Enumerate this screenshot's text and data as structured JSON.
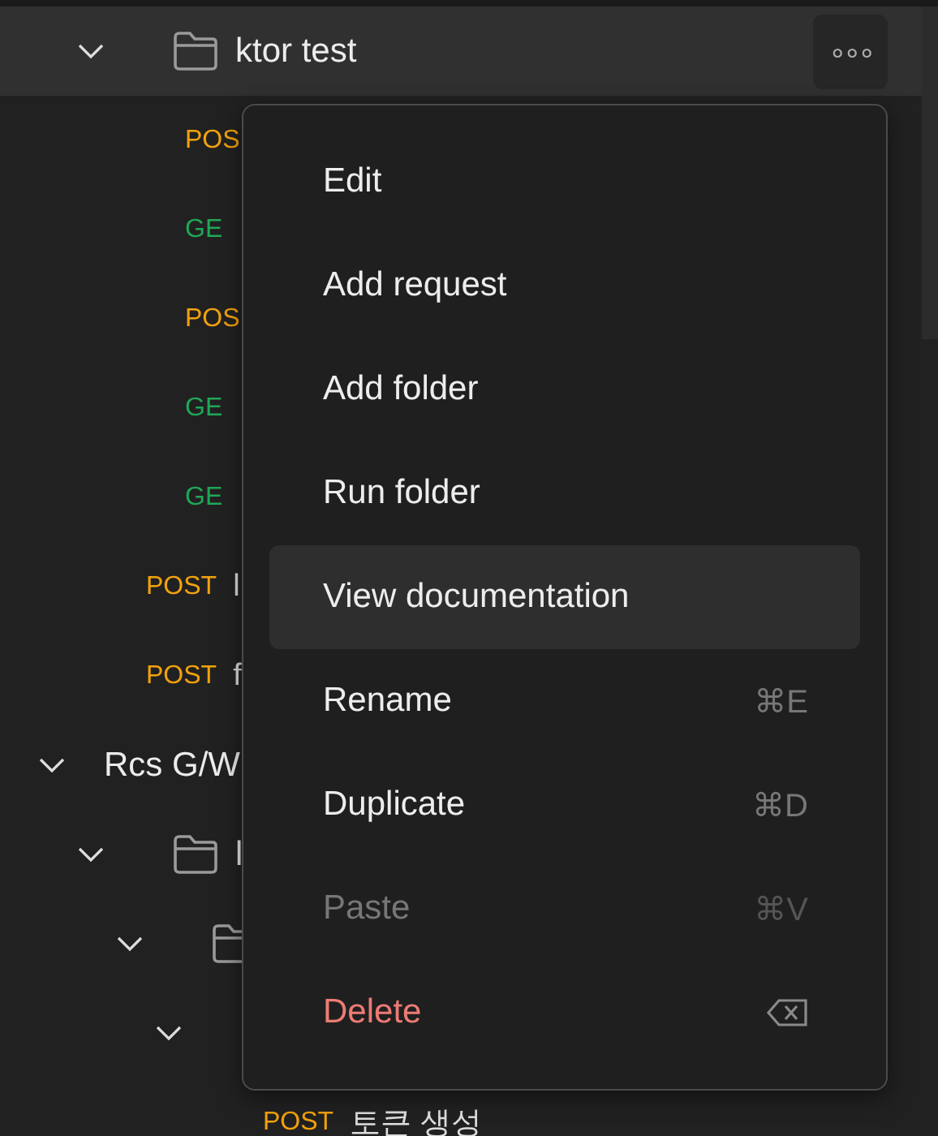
{
  "tree": [
    {
      "kind": "folder",
      "name": "ktor test",
      "expanded": true,
      "menu_open": true,
      "more_label": "∘∘∘",
      "children": [
        {
          "kind": "request",
          "method": "POS",
          "color": "#f2a20c"
        },
        {
          "kind": "request",
          "method": "GE",
          "color": "#1fa757"
        },
        {
          "kind": "request",
          "method": "POS",
          "color": "#f2a20c"
        },
        {
          "kind": "request",
          "method": "GE",
          "color": "#1fa757"
        },
        {
          "kind": "request",
          "method": "GE",
          "color": "#1fa757"
        }
      ]
    },
    {
      "kind": "request",
      "method": "POST",
      "name": "l",
      "color": "#f2a20c"
    },
    {
      "kind": "request",
      "method": "POST",
      "name": "f",
      "color": "#f2a20c"
    }
  ],
  "tree_2": [
    {
      "kind": "collection",
      "name": "Rcs G/W",
      "expanded": true,
      "children": [
        {
          "kind": "folder",
          "name": "l",
          "expanded": true,
          "children": [
            {
              "kind": "folder",
              "expanded": true,
              "children": [
                {
                  "expanded": true,
                  "children": [
                    {
                      "kind": "request",
                      "method": "POST",
                      "name": "토큰 생성",
                      "color": "#f2a20c"
                    }
                  ]
                }
              ]
            }
          ]
        }
      ]
    }
  ],
  "menu": [
    {
      "label": "Edit",
      "kind": "normal",
      "selected": false
    },
    {
      "label": "Add request",
      "kind": "normal",
      "selected": false
    },
    {
      "label": "Add folder",
      "kind": "normal",
      "selected": false
    },
    {
      "label": "Run folder",
      "kind": "normal",
      "selected": false
    },
    {
      "label": "View documentation",
      "kind": "normal",
      "selected": true
    },
    {
      "label": "Rename",
      "kind": "normal",
      "shortcut": "⌘E",
      "selected": false
    },
    {
      "label": "Duplicate",
      "kind": "normal",
      "shortcut": "⌘D",
      "selected": false
    },
    {
      "label": "Paste",
      "kind": "disabled",
      "shortcut": "⌘V",
      "selected": false
    },
    {
      "label": "Delete",
      "kind": "danger",
      "backspace_icon": true,
      "selected": false
    }
  ]
}
